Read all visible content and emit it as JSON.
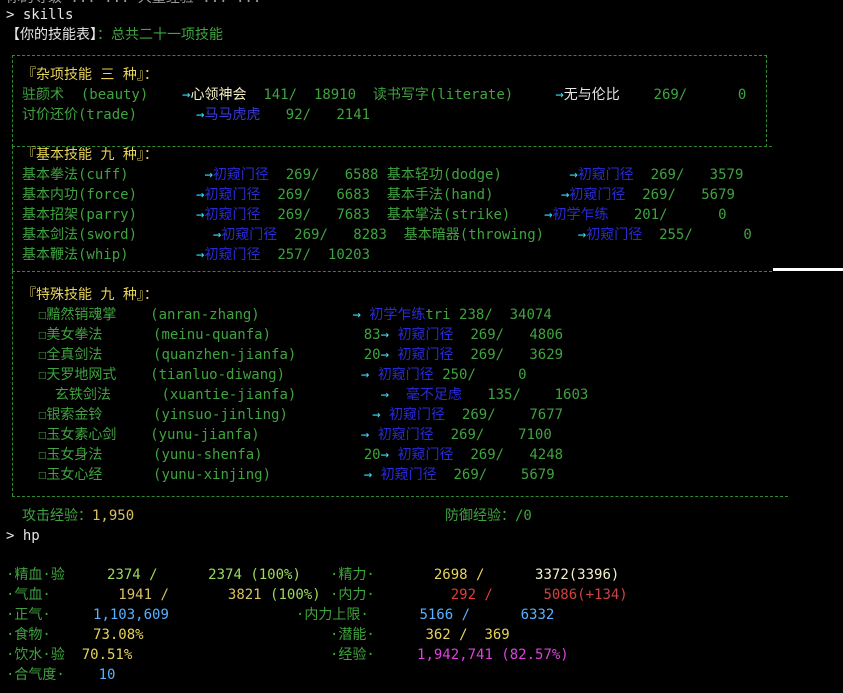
{
  "top_line": "你的等级 ... ... 大量经验 ... ...",
  "prompt1": "> skills",
  "header": {
    "title": "【你的技能表】",
    "summary": "：总共二十一项技能"
  },
  "misc": {
    "title": "『杂项技能 三 种』：",
    "rows": [
      {
        "name": "驻颜术",
        "id": "(beauty)",
        "lvl": "心领神会",
        "val": "141/",
        "exp": "18910",
        "name2": "读书写字(literate)",
        "lvl2": "无与伦比",
        "val2": "269/",
        "exp2": "0"
      },
      {
        "name": "讨价还价",
        "id": "(trade)",
        "lvl": "马马虎虎",
        "val": "92/",
        "exp": "2141"
      }
    ]
  },
  "basic": {
    "title": "『基本技能 九 种』：",
    "rows": [
      {
        "a": "基本拳法(cuff)",
        "al": "初窥门径",
        "av": "269/",
        "ae": "6588",
        "b": "基本轻功(dodge)",
        "bl": "初窥门径",
        "bv": "269/",
        "be": "3579"
      },
      {
        "a": "基本内功(force)",
        "al": "初窥门径",
        "av": "269/",
        "ae": "6683",
        "b": "基本手法(hand)",
        "bl": "初窥门径",
        "bv": "269/",
        "be": "5679"
      },
      {
        "a": "基本招架(parry)",
        "al": "初窥门径",
        "av": "269/",
        "ae": "7683",
        "b": "基本掌法(strike)",
        "bl": "初学乍练",
        "bv": "201/",
        "be": "0"
      },
      {
        "a": "基本剑法(sword)",
        "al": "初窥门径",
        "av": "269/",
        "ae": "8283",
        "b": "基本暗器(throwing)",
        "bl": "初窥门径",
        "bv": "255/",
        "be": "0"
      },
      {
        "a": "基本鞭法(whip)",
        "al": "初窥门径",
        "av": "257/",
        "ae": "10203"
      }
    ]
  },
  "special": {
    "title": "『特殊技能 九 种』：",
    "rows": [
      {
        "name": "☐黯然销魂掌",
        "id": "(anran-zhang)",
        "lvl": "初学乍练",
        "val": "tri 238/",
        "exp": "34074"
      },
      {
        "name": "☐美女拳法",
        "id": "(meinu-quanfa)",
        "pre": "83",
        "lvl": "初窥门径",
        "val": "269/",
        "exp": "4806"
      },
      {
        "name": "☐全真剑法",
        "id": "(quanzhen-jianfa)",
        "pre": "20",
        "lvl": "初窥门径",
        "val": "269/",
        "exp": "3629"
      },
      {
        "name": "☐天罗地网式",
        "id": "(tianluo-diwang)",
        "lvl": "初窥门径",
        "val": "250/",
        "exp": "0"
      },
      {
        "name": "玄铁剑法",
        "id": "(xuantie-jianfa)",
        "lvl": "毫不足虑",
        "val": "135/",
        "exp": "1603"
      },
      {
        "name": "☐银索金铃",
        "id": "(yinsuo-jinling)",
        "lvl": "初窥门径",
        "val": "269/",
        "exp": "7677"
      },
      {
        "name": "☐玉女素心剑",
        "id": "(yunu-jianfa)",
        "lvl": "初窥门径",
        "val": "269/",
        "exp": "7100"
      },
      {
        "name": "☐玉女身法",
        "id": "(yunu-shenfa)",
        "pre": "20",
        "lvl": "初窥门径",
        "val": "269/",
        "exp": "4248"
      },
      {
        "name": "☐玉女心经",
        "id": "(yunu-xinjing)",
        "lvl": "初窥门径",
        "val": "269/",
        "exp": "5679"
      }
    ]
  },
  "combat": {
    "atk_label": "攻击经验：",
    "atk_val": "1,950",
    "def_label": "防御经验：",
    "def_val": "/0"
  },
  "prompt2": "> hp",
  "hp": {
    "jingxue": {
      "label": "·精血·验",
      "cur": "2374 /",
      "max": "2374",
      "pct": "(100%)"
    },
    "jingli": {
      "label": "·精力·",
      "cur": "2698 /",
      "max": "3372(3396)"
    },
    "qixue": {
      "label": "·气血·",
      "cur": "1941 /",
      "max": "3821",
      "pct": "(100%)"
    },
    "neili": {
      "label": "·内力·",
      "cur": "292 /",
      "max": "5086(+134)"
    },
    "zhengqi": {
      "label": "·正气·",
      "val": "1,103,609"
    },
    "neili_max": {
      "label": "·内力上限·",
      "cur": "5166 /",
      "max": "6332"
    },
    "food": {
      "label": "·食物·",
      "val": "73.08%"
    },
    "qianneng": {
      "label": "·潜能·",
      "cur": "362 /",
      "max": "369"
    },
    "water": {
      "label": "·饮水·验",
      "val": "70.51%"
    },
    "exp": {
      "label": "·经验·",
      "val": "1,942,741 (82.57%)"
    },
    "heqidu": {
      "label": "·合气度·",
      "val": "10"
    }
  }
}
